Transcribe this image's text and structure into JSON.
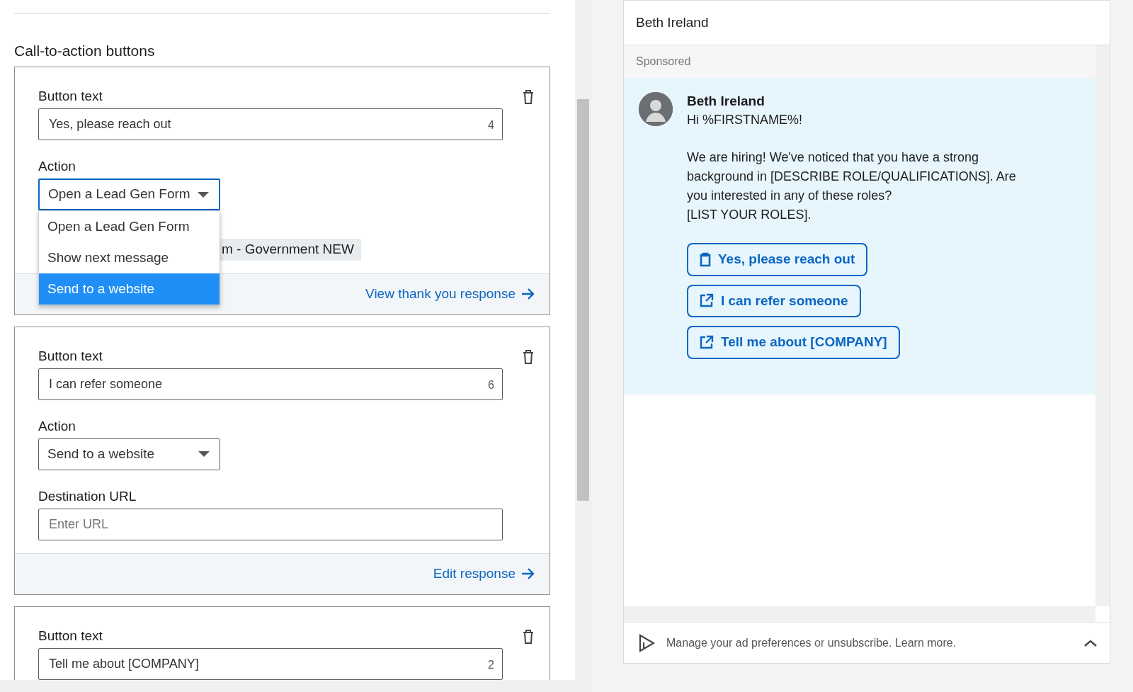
{
  "section_title": "Call-to-action buttons",
  "cta_cards": [
    {
      "button_text_label": "Button text",
      "button_text_value": "Yes, please reach out",
      "char_count": "4",
      "action_label": "Action",
      "action_value": "Open a Lead Gen Form",
      "action_focused": true,
      "dropdown_options": [
        {
          "label": "Open a Lead Gen Form",
          "selected": false
        },
        {
          "label": "Show next message",
          "selected": false
        },
        {
          "label": "Send to a website",
          "selected": true
        }
      ],
      "form_chip": "m - Government NEW",
      "footer_link": "View thank you response"
    },
    {
      "button_text_label": "Button text",
      "button_text_value": "I can refer someone",
      "char_count": "6",
      "action_label": "Action",
      "action_value": "Send to a website",
      "action_focused": false,
      "destination_label": "Destination URL",
      "destination_placeholder": "Enter URL",
      "footer_link": "Edit response"
    },
    {
      "button_text_label": "Button text",
      "button_text_value": "Tell me about [COMPANY]",
      "char_count": "2"
    }
  ],
  "preview": {
    "header": "Beth Ireland",
    "sponsored": "Sponsored",
    "sender": "Beth Ireland",
    "message": [
      {
        "lines": [
          "Hi %FIRSTNAME%!"
        ]
      },
      {
        "lines": [
          "We are hiring! We've noticed that you have a strong background in [DESCRIBE ROLE/QUALIFICATIONS]. Are you interested in any of these roles?",
          "[LIST YOUR ROLES]."
        ]
      }
    ],
    "buttons": [
      {
        "label": "Yes, please reach out",
        "kind": "clipboard"
      },
      {
        "label": "I can refer someone",
        "kind": "external-link"
      },
      {
        "label": "Tell me about [COMPANY]",
        "kind": "external-link"
      }
    ],
    "footer": [
      {
        "text": "Manage your ad preferences",
        "link": true
      },
      {
        "text": "or",
        "link": false
      },
      {
        "text": "unsubscribe.",
        "link": true
      },
      {
        "text": "Learn more.",
        "link": true
      }
    ]
  }
}
